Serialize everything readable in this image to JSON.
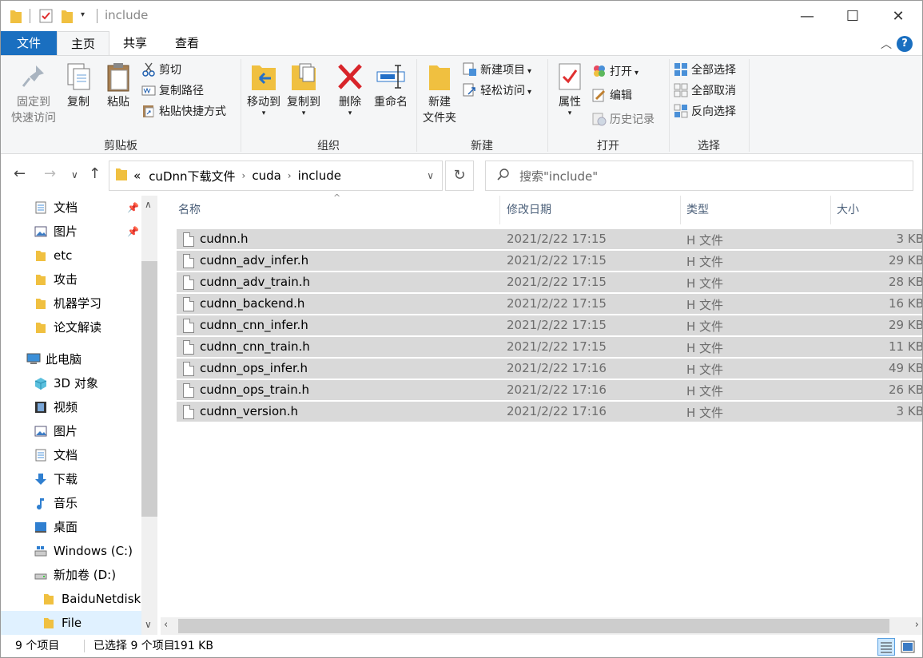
{
  "window": {
    "title": "include",
    "controls": {
      "minimize": "—",
      "maximize": "☐",
      "close": "✕"
    }
  },
  "ribbon_tabs": [
    {
      "label": "文件"
    },
    {
      "label": "主页"
    },
    {
      "label": "共享"
    },
    {
      "label": "查看"
    }
  ],
  "ribbon": {
    "clipboard": {
      "group_label": "剪贴板",
      "pin_label_1": "固定到",
      "pin_label_2": "快速访问",
      "copy_label": "复制",
      "paste_label": "粘贴",
      "cut_label": "剪切",
      "copy_path_label": "复制路径",
      "paste_shortcut_label": "粘贴快捷方式"
    },
    "organize": {
      "group_label": "组织",
      "move_to_label": "移动到",
      "copy_to_label": "复制到",
      "delete_label": "删除",
      "rename_label": "重命名"
    },
    "new": {
      "group_label": "新建",
      "new_folder_label_1": "新建",
      "new_folder_label_2": "文件夹",
      "new_item_label": "新建项目",
      "easy_access_label": "轻松访问"
    },
    "open": {
      "group_label": "打开",
      "properties_label": "属性",
      "open_label": "打开",
      "edit_label": "编辑",
      "history_label": "历史记录"
    },
    "select": {
      "group_label": "选择",
      "select_all_label": "全部选择",
      "select_none_label": "全部取消",
      "invert_label": "反向选择"
    }
  },
  "address": {
    "overflow": "«",
    "crumbs": [
      "cuDnn下载文件",
      "cuda",
      "include"
    ],
    "search_placeholder": "搜索\"include\""
  },
  "nav_pane": {
    "items": [
      {
        "label": "文档",
        "icon": "documents-icon",
        "pinned": true
      },
      {
        "label": "图片",
        "icon": "pictures-icon",
        "pinned": true
      },
      {
        "label": "etc",
        "icon": "folder-icon"
      },
      {
        "label": "攻击",
        "icon": "folder-icon"
      },
      {
        "label": "机器学习",
        "icon": "folder-icon"
      },
      {
        "label": "论文解读",
        "icon": "folder-icon"
      },
      {
        "label": "此电脑",
        "icon": "computer-icon"
      },
      {
        "label": "3D 对象",
        "icon": "3d-objects-icon"
      },
      {
        "label": "视频",
        "icon": "videos-icon"
      },
      {
        "label": "图片",
        "icon": "pictures-icon"
      },
      {
        "label": "文档",
        "icon": "documents-icon"
      },
      {
        "label": "下载",
        "icon": "downloads-icon"
      },
      {
        "label": "音乐",
        "icon": "music-icon"
      },
      {
        "label": "桌面",
        "icon": "desktop-icon"
      },
      {
        "label": "Windows (C:)",
        "icon": "drive-c-icon"
      },
      {
        "label": "新加卷 (D:)",
        "icon": "drive-d-icon"
      },
      {
        "label": "BaiduNetdiskI",
        "icon": "folder-icon"
      },
      {
        "label": "File",
        "icon": "folder-icon"
      }
    ]
  },
  "file_list": {
    "columns": {
      "name": "名称",
      "date": "修改日期",
      "type": "类型",
      "size": "大小"
    },
    "rows": [
      {
        "name": "cudnn.h",
        "date": "2021/2/22 17:15",
        "type": "H 文件",
        "size": "3 KB"
      },
      {
        "name": "cudnn_adv_infer.h",
        "date": "2021/2/22 17:15",
        "type": "H 文件",
        "size": "29 KB"
      },
      {
        "name": "cudnn_adv_train.h",
        "date": "2021/2/22 17:15",
        "type": "H 文件",
        "size": "28 KB"
      },
      {
        "name": "cudnn_backend.h",
        "date": "2021/2/22 17:15",
        "type": "H 文件",
        "size": "16 KB"
      },
      {
        "name": "cudnn_cnn_infer.h",
        "date": "2021/2/22 17:15",
        "type": "H 文件",
        "size": "29 KB"
      },
      {
        "name": "cudnn_cnn_train.h",
        "date": "2021/2/22 17:15",
        "type": "H 文件",
        "size": "11 KB"
      },
      {
        "name": "cudnn_ops_infer.h",
        "date": "2021/2/22 17:16",
        "type": "H 文件",
        "size": "49 KB"
      },
      {
        "name": "cudnn_ops_train.h",
        "date": "2021/2/22 17:16",
        "type": "H 文件",
        "size": "26 KB"
      },
      {
        "name": "cudnn_version.h",
        "date": "2021/2/22 17:16",
        "type": "H 文件",
        "size": "3 KB"
      }
    ]
  },
  "status": {
    "item_count": "9 个项目",
    "selection": "已选择 9 个项目",
    "size": "191 KB"
  },
  "colors": {
    "accent": "#1a6fc0",
    "folder": "#f0c040",
    "selection": "#d9d9d9"
  }
}
